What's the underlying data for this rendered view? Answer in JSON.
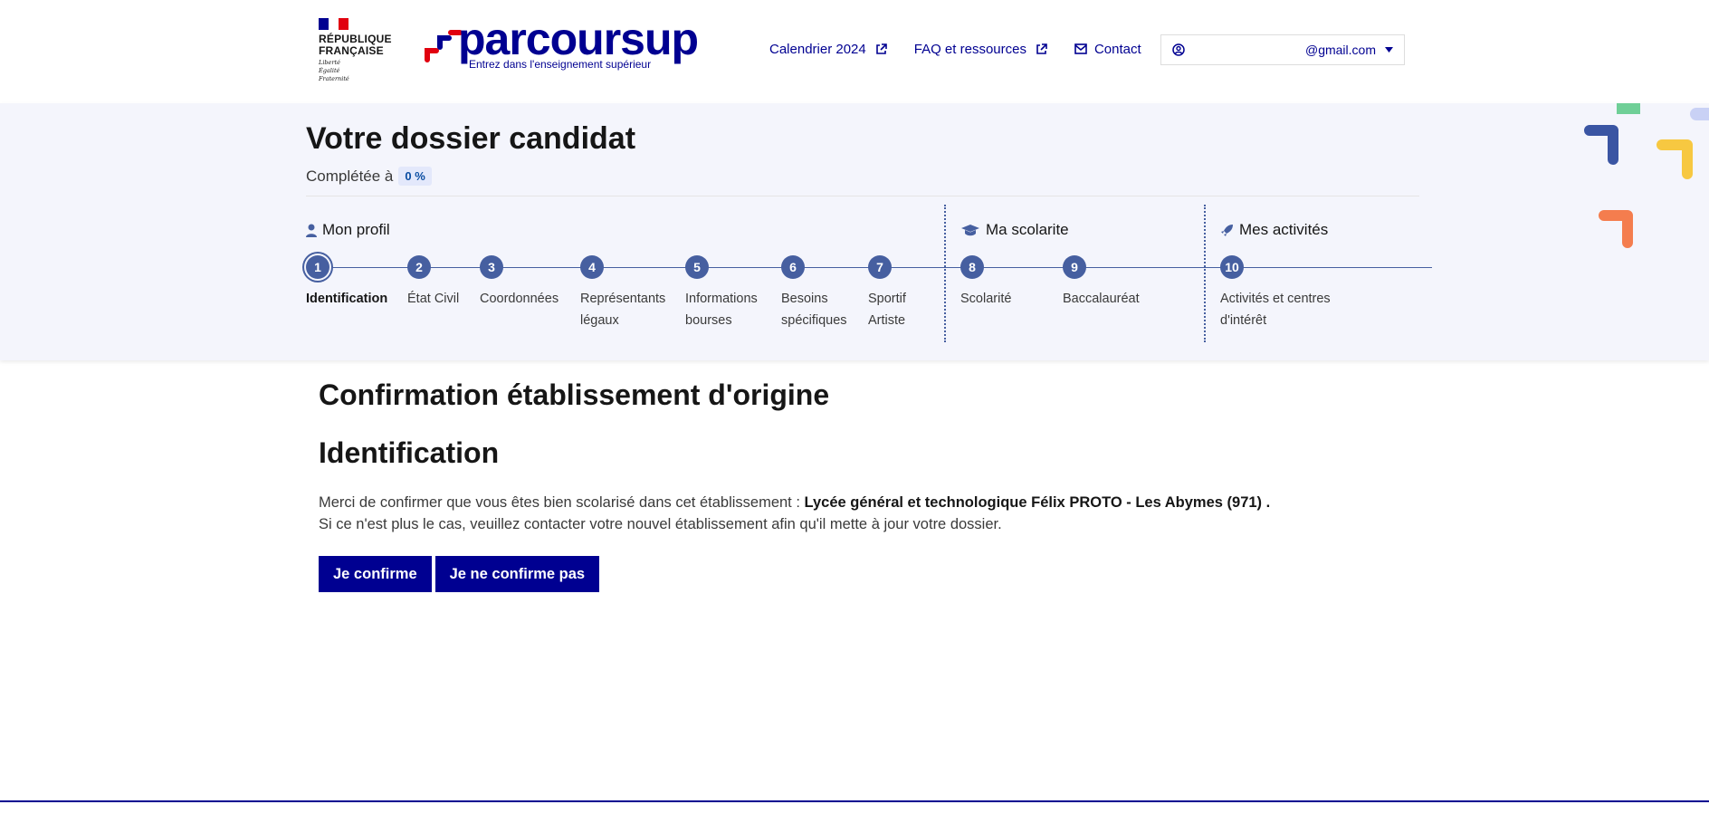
{
  "header": {
    "rf_line1": "RÉPUBLIQUE",
    "rf_line2": "FRANÇAISE",
    "devise": [
      "Liberté",
      "Égalité",
      "Fraternité"
    ],
    "logo_word": "parcoursup",
    "logo_tagline": "Entrez dans l'enseignement supérieur",
    "nav": {
      "calendar": "Calendrier 2024",
      "faq": "FAQ et ressources",
      "contact": "Contact"
    },
    "account_email": "@gmail.com"
  },
  "dossier": {
    "title": "Votre dossier candidat",
    "completion_label": "Complétée à",
    "completion_value": "0 %",
    "sections": {
      "profil": "Mon profil",
      "scolarite": "Ma scolarite",
      "activites": "Mes activités"
    },
    "steps": [
      {
        "num": "1",
        "label": "Identification",
        "active": true
      },
      {
        "num": "2",
        "label": "État Civil"
      },
      {
        "num": "3",
        "label": "Coordonnées"
      },
      {
        "num": "4",
        "label": "Représentants légaux"
      },
      {
        "num": "5",
        "label": "Informations bourses"
      },
      {
        "num": "6",
        "label": "Besoins spécifiques"
      },
      {
        "num": "7",
        "label": "Sportif Artiste"
      },
      {
        "num": "8",
        "label": "Scolarité"
      },
      {
        "num": "9",
        "label": "Baccalauréat"
      },
      {
        "num": "10",
        "label": "Activités et centres d'intérêt"
      }
    ]
  },
  "main": {
    "heading": "Confirmation établissement d'origine",
    "subheading": "Identification",
    "para_prefix": "Merci de confirmer que vous êtes bien scolarisé dans cet établissement : ",
    "establishment": "Lycée général et technologique Félix PROTO - Les Abymes (971) .",
    "para_line2": "Si ce n'est plus le cas, veuillez contacter votre nouvel établissement afin qu'il mette à jour votre dossier.",
    "confirm_label": "Je confirme",
    "deny_label": "Je ne confirme pas"
  },
  "colors": {
    "brand_blue": "#000091",
    "step_blue": "#465fa0",
    "band_bg": "#f4f5fc"
  }
}
